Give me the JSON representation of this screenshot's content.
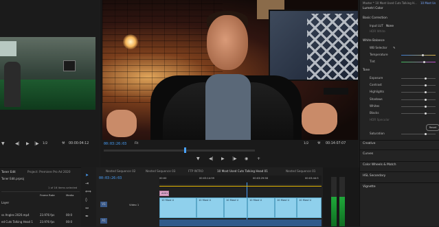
{
  "source_monitor": {
    "page_indicator": "1/2",
    "timecode": "00:00:04:12",
    "wrench": "wrench-icon"
  },
  "program_monitor": {
    "title": "Master * 10 Most Used Cuts Talking H...",
    "tab2": "10 Most Us",
    "timecode": "00:03:26:03",
    "fit": "Fit",
    "page_indicator": "1/2",
    "duration": "00:14:07:07"
  },
  "lumetri": {
    "header": "Lumetri Color",
    "basic_correction": "Basic Correction",
    "input_lut_label": "Input LUT",
    "input_lut_value": "None",
    "hdr_white": "HDR White",
    "white_balance": "White Balance",
    "wb_selector": "WB Selector",
    "temperature": "Temperature",
    "tint": "Tint",
    "tone": "Tone",
    "exposure": "Exposure",
    "contrast": "Contrast",
    "highlights": "Highlights",
    "shadows": "Shadows",
    "whites": "Whites",
    "blacks": "Blacks",
    "hdr_specular": "HDR Specular",
    "reset": "Reset",
    "saturation": "Saturation",
    "creative": "Creative",
    "curves": "Curves",
    "color_wheels": "Color Wheels & Match",
    "hsl_secondary": "HSL Secondary",
    "vignette": "Vignette"
  },
  "project": {
    "tab1": "Toner Edit",
    "tab2": "Project: Premiere Pro Ad 2020",
    "file": "Toner Edit.prproj",
    "items_selected": "1 of 16 items selected",
    "col_framerate": "Frame Rate",
    "col_media": "Media",
    "folder": "Layer",
    "row1_name": "ss Angles 2020.mp4",
    "row1_fps": "23.976 fps",
    "row1_media": "00:0",
    "row2_name": "ed Cuts Talking Head 1",
    "row2_fps": "23.976 fps",
    "row2_media": "00:0"
  },
  "timeline": {
    "tabs": [
      "Nested Sequence 02",
      "Nested Sequence 03",
      "FTP INTRO",
      "10 Most Used Cuts Talking Head 01",
      "Nested Sequence 01"
    ],
    "timecode": "00:03:26:03",
    "ruler": [
      "00:00",
      "00:03:14:59",
      "00:03:29:58",
      "00:03:44:5"
    ],
    "track_v1": "V1",
    "track_video1": "Video 1",
    "track_a1": "A1",
    "clip_label": "A001",
    "clip_text": "10 Most U"
  }
}
